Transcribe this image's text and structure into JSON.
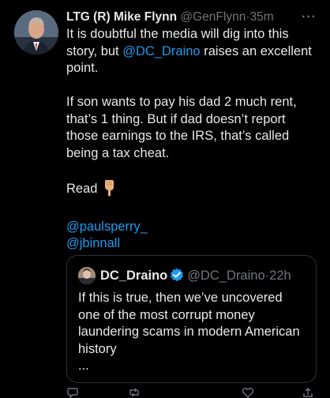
{
  "tweet": {
    "display_name": "LTG (R) Mike Flynn",
    "handle": "@GenFlynn",
    "separator": "·",
    "time": "35m",
    "more": "···",
    "body_lines_1": [
      "It is doubtful the media will dig into this",
      "story, but ",
      "@DC_Draino",
      " raises an excellent",
      "point."
    ],
    "body_lines_2": [
      "If son wants to pay his dad 2 much rent,",
      "that’s 1 thing. But if dad doesn’t report",
      "those earnings to the IRS, that’s called",
      "being a tax cheat."
    ],
    "read_text": "Read",
    "mentions": [
      "@paulsperry_",
      "@jbinnall"
    ]
  },
  "quote": {
    "display_name": "DC_Draino",
    "handle": "@DC_Draino",
    "separator": "·",
    "time": "22h",
    "body_lines": [
      "If this is true, then we’ve uncovered",
      "one of the most corrupt money",
      "laundering scams in modern American",
      "history",
      "..."
    ]
  },
  "colors": {
    "background": "#000000",
    "text": "#e7e9ea",
    "muted": "#71767b",
    "link": "#1d9bf0",
    "border": "#2f3336"
  },
  "icons": {
    "main_avatar": "avatar",
    "quote_avatar": "avatar",
    "verified": "verified-badge-icon",
    "read_emoji": "pointing-down-hand-icon",
    "actions": [
      "reply-icon",
      "retweet-icon",
      "like-icon",
      "share-icon"
    ]
  }
}
